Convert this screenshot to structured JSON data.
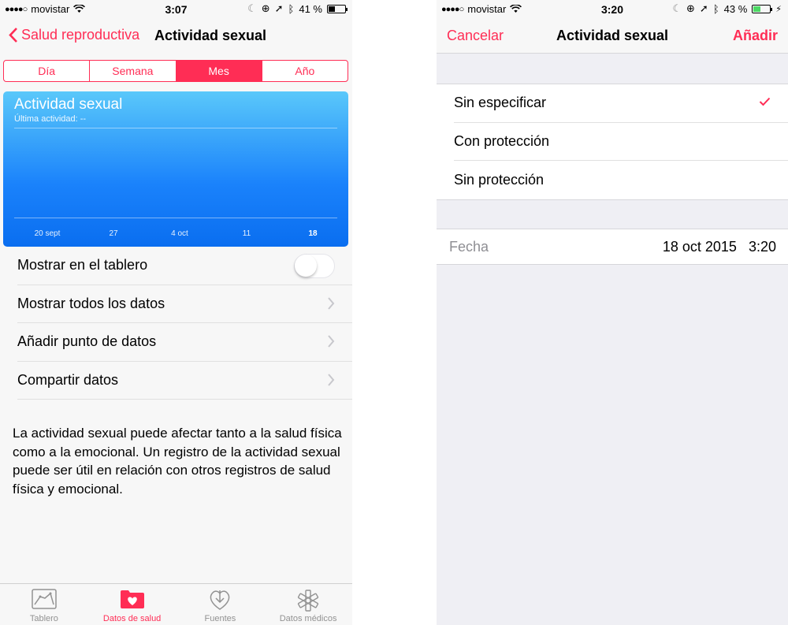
{
  "left": {
    "status": {
      "carrier": "movistar",
      "time": "3:07",
      "battery": "41 %",
      "battery_level": 0.41
    },
    "nav": {
      "back_label": "Salud reproductiva",
      "title": "Actividad sexual"
    },
    "segments": [
      "Día",
      "Semana",
      "Mes",
      "Año"
    ],
    "active_segment": "Mes",
    "chart": {
      "title": "Actividad sexual",
      "subtitle": "Última actividad: --",
      "x_labels": [
        "20 sept",
        "27",
        "4 oct",
        "11",
        "18"
      ]
    },
    "rows": {
      "show_dashboard": "Mostrar en el tablero",
      "show_all": "Mostrar todos los datos",
      "add_point": "Añadir punto de datos",
      "share": "Compartir datos"
    },
    "toggle_on": false,
    "description": "La actividad sexual puede afectar tanto a la salud física como a la emocional. Un registro de la actividad sexual puede ser útil en relación con otros registros de salud física y emocional.",
    "tabs": [
      "Tablero",
      "Datos de salud",
      "Fuentes",
      "Datos médicos"
    ],
    "active_tab": "Datos de salud"
  },
  "right": {
    "status": {
      "carrier": "movistar",
      "time": "3:20",
      "battery": "43 %",
      "battery_level": 0.43
    },
    "nav": {
      "cancel_label": "Cancelar",
      "title": "Actividad sexual",
      "add_label": "Añadir"
    },
    "options": [
      "Sin especificar",
      "Con protección",
      "Sin protección"
    ],
    "selected_option": "Sin especificar",
    "date": {
      "label": "Fecha",
      "date_value": "18 oct 2015",
      "time_value": "3:20"
    }
  },
  "colors": {
    "accent": "#ff2d55",
    "chart_top": "#5ac8fa",
    "chart_bottom": "#0a6ef0",
    "battery_green": "#4cd964"
  }
}
